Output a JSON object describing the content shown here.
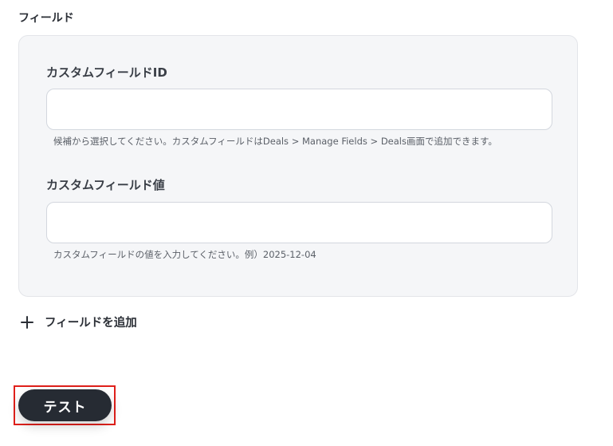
{
  "section": {
    "label": "フィールド"
  },
  "fields": [
    {
      "label": "カスタムフィールドID",
      "value": "",
      "help": "候補から選択してください。カスタムフィールドはDeals > Manage Fields > Deals画面で追加できます。"
    },
    {
      "label": "カスタムフィールド値",
      "value": "",
      "help": "カスタムフィールドの値を入力してください。例）2025-12-04"
    }
  ],
  "add_field": {
    "label": "フィールドを追加",
    "icon": "plus-icon"
  },
  "test_button": {
    "label": "テスト"
  },
  "colors": {
    "highlight": "#e0201b",
    "button_bg": "#262b33",
    "card_bg": "#f5f6f8"
  }
}
